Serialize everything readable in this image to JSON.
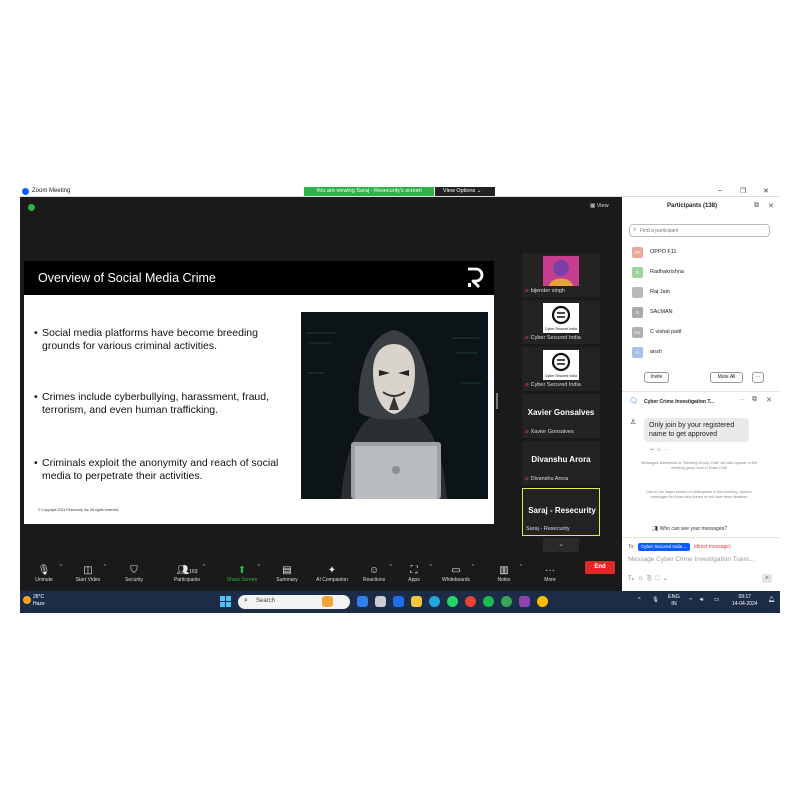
{
  "window": {
    "title": "Zoom Meeting",
    "viewing_banner": "You are viewing Saraj - Resecurity's screen",
    "view_options": "View Options",
    "minimize": "–",
    "maximize": "❐",
    "close": "✕"
  },
  "stage": {
    "view_label": "View"
  },
  "slide": {
    "title": "Overview of Social Media Crime",
    "bullets": [
      "Social media platforms have become breeding grounds for various criminal activities.",
      "Crimes include cyberbullying, harassment, fraud, terrorism, and even human trafficking.",
      "Criminals exploit the anonymity and reach of social media to perpetrate their activities."
    ],
    "copyright": "© Copyright 2024 Resecurity Inc. All rights reserved."
  },
  "tiles": [
    {
      "name": "bijender singh",
      "big": ""
    },
    {
      "name": "Cyber Secured India",
      "big": ""
    },
    {
      "name": "Cyber Secured India",
      "big": ""
    },
    {
      "name": "Xavier Gonsalves",
      "big": "Xavier Gonsalves"
    },
    {
      "name": "Divanshu Arora",
      "big": "Divanshu Arora"
    },
    {
      "name": "Saraj - Resecurity",
      "big": "Saraj - Resecurity"
    }
  ],
  "avatar_caption": "Cyber Secured India",
  "toolbar": {
    "unmute": "Unmute",
    "start_video": "Start Video",
    "security": "Security",
    "participants": "Participants",
    "participants_count": "163",
    "share_screen": "Share Screen",
    "summary": "Summary",
    "ai_companion": "AI Companion",
    "reactions": "Reactions",
    "apps": "Apps",
    "whiteboards": "Whiteboards",
    "notes": "Notes",
    "more": "More",
    "end": "End"
  },
  "participants_panel": {
    "title": "Participants (138)",
    "search_placeholder": "Find a participant",
    "list": [
      {
        "initials": "OF",
        "name": "OPPO F11",
        "color": "#e8a99a"
      },
      {
        "initials": "R",
        "name": "Radhakrishna",
        "color": "#9fd49a"
      },
      {
        "initials": "",
        "name": "Raj Jain",
        "color": "#b8b8b8"
      },
      {
        "initials": "S",
        "name": "SALMAN",
        "color": "#a8a8a8"
      },
      {
        "initials": "CV",
        "name": "C vishal patil",
        "color": "#b0b0b0"
      },
      {
        "initials": "A",
        "name": "ansh",
        "color": "#a8bfe8"
      }
    ],
    "invite": "Invite",
    "mute_all": "Mute All",
    "more": "···"
  },
  "chat": {
    "title": "Cyber Crime Investigation T...",
    "menu": "···",
    "message": "Only join by your registered name to get approved",
    "note1": "Messages addressed to \"Meeting Group Chat\" will also appear in the meeting group chat in Team Chat",
    "note2": "Due to the large number of participants in this meeting, system messages for those who joined or left have been disabled",
    "who_can_see": "Who can see your messages?",
    "to_label": "To:",
    "to_recipient": "Cyber Secured India",
    "to_direct": "(direct message)",
    "input_placeholder": "Message Cyber Crime Investigation Traini..."
  },
  "taskbar": {
    "temp": "28°C",
    "weather": "Haze",
    "search": "Search",
    "lang1": "ENG",
    "lang2": "IN",
    "time": "09:17",
    "date": "14-04-2024"
  }
}
